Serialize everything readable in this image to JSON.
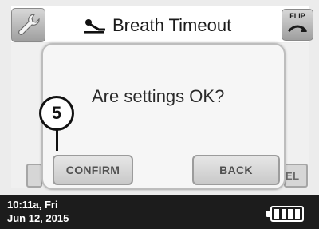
{
  "header": {
    "title": "Breath Timeout",
    "flip_label": "FLIP",
    "left_icon": "wrench-icon",
    "title_icon": "person-lying-icon",
    "right_icon": "flip-arrow-icon"
  },
  "dialog": {
    "message": "Are settings OK?",
    "confirm_label": "CONFIRM",
    "back_label": "BACK"
  },
  "background": {
    "right_button_partial": "EL"
  },
  "callout": {
    "number": "5"
  },
  "status_bar": {
    "time": "10:11a, Fri",
    "date": "Jun 12, 2015",
    "battery_icon": "battery-icon",
    "battery_level": 1.0
  },
  "colors": {
    "status_bar_bg": "#1c1c1c",
    "dialog_bg": "#f6f6f6",
    "button_text": "#505050"
  }
}
